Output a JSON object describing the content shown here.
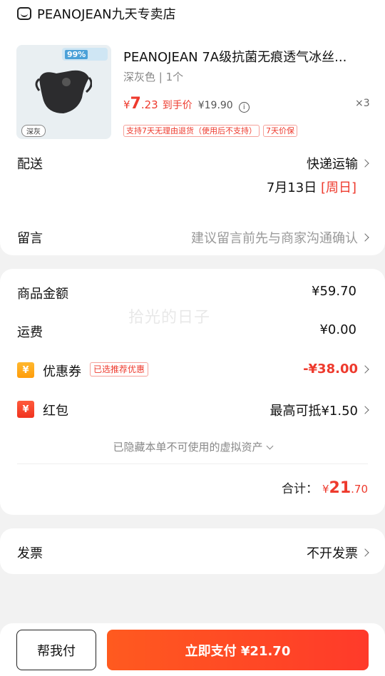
{
  "shop": {
    "name": "PEANOJEAN九天专卖店",
    "icon": "shop-icon"
  },
  "product": {
    "title": "PEANOJEAN 7A级抗菌无痕透气冰丝...",
    "variant": "深灰色 | 1个",
    "image_badge": "99%",
    "image_tag": "深灰",
    "price_currency": "¥",
    "price_int": "7",
    "price_dec": ".23",
    "price_label": "到手价",
    "original_price": "¥19.90",
    "quantity": "×3",
    "tags": [
      "支持7天无理由退货（使用后不支持）",
      "7天价保"
    ]
  },
  "delivery": {
    "label": "配送",
    "method": "快递运输",
    "date": "7月13日",
    "weekday": "[周日]"
  },
  "message": {
    "label": "留言",
    "placeholder": "建议留言前先与商家沟通确认"
  },
  "summary": {
    "goods_label": "商品金额",
    "goods_value": "¥59.70",
    "shipping_label": "运费",
    "shipping_value": "¥0.00",
    "coupon_label": "优惠券",
    "coupon_tag": "已选推荐优惠",
    "coupon_value": "-¥38.00",
    "redpack_label": "红包",
    "redpack_value": "最高可抵¥1.50",
    "hidden_note": "已隐藏本单不可使用的虚拟资产",
    "total_label": "合计：",
    "total_currency": "¥",
    "total_int": "21",
    "total_dec": ".70"
  },
  "watermark": "拾光的日子",
  "invoice": {
    "label": "发票",
    "value": "不开发票"
  },
  "actions": {
    "help_label": "帮我付",
    "pay_label": "立即支付 ¥21.70"
  },
  "colors": {
    "accent": "#ee3a2d",
    "pay_button": "#ff4a25"
  }
}
